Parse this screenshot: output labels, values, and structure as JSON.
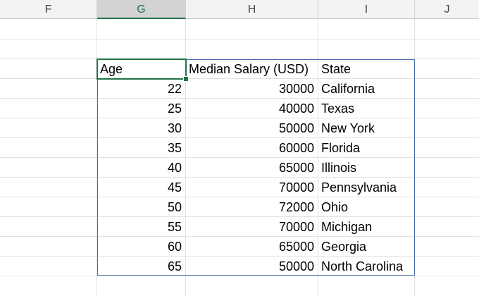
{
  "columns": [
    "F",
    "G",
    "H",
    "I",
    "J"
  ],
  "table": {
    "headers": [
      "Age",
      "Median Salary (USD)",
      "State"
    ],
    "rows": [
      [
        "22",
        "30000",
        "California"
      ],
      [
        "25",
        "40000",
        "Texas"
      ],
      [
        "30",
        "50000",
        "New York"
      ],
      [
        "35",
        "60000",
        "Florida"
      ],
      [
        "40",
        "65000",
        "Illinois"
      ],
      [
        "45",
        "70000",
        "Pennsylvania"
      ],
      [
        "50",
        "72000",
        "Ohio"
      ],
      [
        "55",
        "70000",
        "Michigan"
      ],
      [
        "60",
        "65000",
        "Georgia"
      ],
      [
        "65",
        "50000",
        "North Carolina"
      ]
    ]
  },
  "active_cell_column": "G",
  "colors": {
    "selection_green": "#217346",
    "table_border_blue": "#4a6fb5",
    "header_bg": "#f3f3f3",
    "gridline": "#e1e1e1"
  }
}
